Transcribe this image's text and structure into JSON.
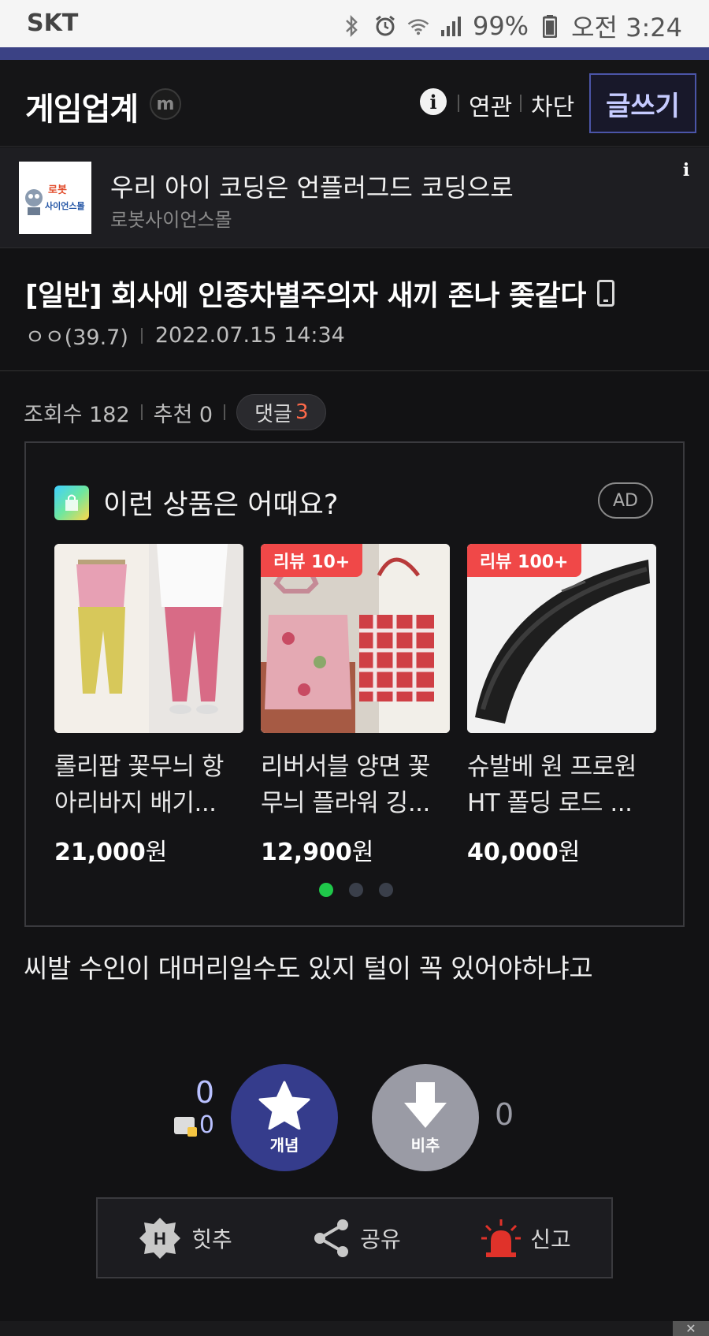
{
  "status_bar": {
    "carrier": "SKT",
    "battery": "99%",
    "time": "오전 3:24"
  },
  "header": {
    "gallery_name": "게임업계",
    "badge": "m",
    "links": [
      "연관",
      "차단"
    ],
    "write_label": "글쓰기"
  },
  "banner_ad": {
    "logo_text_top": "로봇",
    "logo_text_bottom": "사이언스몰",
    "title": "우리 아이 코딩은 언플러그드 코딩으로",
    "advertiser": "로봇사이언스몰"
  },
  "post": {
    "title": "[일반] 회사에 인종차별주의자 새끼 존나 좆같다",
    "author": "ㅇㅇ(39.7)",
    "datetime": "2022.07.15 14:34",
    "views_label": "조회수 182",
    "recommend_label": "추천 0",
    "comments_label": "댓글",
    "comments_count": "3",
    "body": "씨발 수인이 대머리일수도 있지 털이 꼭 있어야하냐고"
  },
  "product_ad": {
    "heading": "이런 상품은 어때요?",
    "ad_label": "AD",
    "products": [
      {
        "badge": "",
        "name": "롤리팝 꽃무늬 항아리바지 배기...",
        "price": "21,000",
        "unit": "원"
      },
      {
        "badge": "리뷰 10+",
        "name": "리버서블 양면 꽃무늬 플라워 깅...",
        "price": "12,900",
        "unit": "원"
      },
      {
        "badge": "리뷰 100+",
        "name": "슈발베 원 프로원 HT 폴딩 로드 ...",
        "price": "40,000",
        "unit": "원"
      }
    ],
    "active_page": 1,
    "page_count": 3
  },
  "votes": {
    "up_count": "0",
    "fixed_up_count": "0",
    "up_label": "개념",
    "down_label": "비추",
    "down_count": "0"
  },
  "actions": {
    "hit_label": "힛추",
    "share_label": "공유",
    "report_label": "신고"
  },
  "colors": {
    "accent": "#3b4285",
    "vote_up": "#353c8c",
    "vote_down": "#9a9ba5",
    "comment_count": "#ff6a4a",
    "badge_red": "#f04848",
    "active_dot": "#1fc84a"
  }
}
